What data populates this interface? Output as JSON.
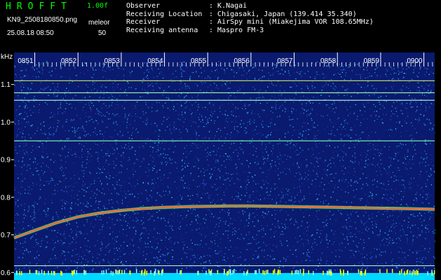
{
  "header": {
    "app_title": "HROFFT",
    "version": "1.00f",
    "filename": "KN9_2508180850.png",
    "datetime": "25.08.18 08:50",
    "mode_label": "meleor",
    "mode_value": "50"
  },
  "info": [
    {
      "key": "Observer",
      "sep": ": ",
      "value": "K.Nagai"
    },
    {
      "key": "Receiving Location",
      "sep": ": ",
      "value": "Chigasaki, Japan (139.414 35.340)"
    },
    {
      "key": "Receiver",
      "sep": ": ",
      "value": "AirSpy mini (Miakejima VOR 108.65MHz)"
    },
    {
      "key": "Receiving antenna",
      "sep": ": ",
      "value": "Maspro FM-3"
    }
  ],
  "chart_data": {
    "type": "heatmap",
    "ylabel": "kHz",
    "y_ticks": [
      "1.1",
      "1.0",
      "0.9",
      "0.8",
      "0.7",
      "0.6"
    ],
    "y_values": [
      1.1,
      1.0,
      0.9,
      0.8,
      0.7,
      0.6
    ],
    "ylim": [
      0.58,
      1.185
    ],
    "x_ticks": [
      "0851",
      "0852",
      "0853",
      "0854",
      "0855",
      "0856",
      "0857",
      "0858",
      "0859",
      "0900"
    ],
    "x_values": [
      0,
      1,
      2,
      3,
      4,
      5,
      6,
      7,
      8,
      9
    ],
    "xlim": [
      -0.48,
      9.25
    ],
    "background_color": "#0a1a6e",
    "noise_colors": [
      "#1e3cc8",
      "#2a6cf0",
      "#3aa0ff",
      "#30e0ff"
    ],
    "carrier_lines": [
      {
        "freq": 1.11,
        "color": "#d8ff6a"
      },
      {
        "freq": 1.078,
        "color": "#a0ffb0"
      },
      {
        "freq": 1.058,
        "color": "#b0ffd8"
      },
      {
        "freq": 0.95,
        "color": "#7cffb0"
      },
      {
        "freq": 0.618,
        "color": "#c0ffd0"
      }
    ],
    "doppler_trace": {
      "color": "#ff4030",
      "points": [
        [
          -0.48,
          0.692
        ],
        [
          0.0,
          0.712
        ],
        [
          0.5,
          0.732
        ],
        [
          1.0,
          0.748
        ],
        [
          1.5,
          0.758
        ],
        [
          2.0,
          0.765
        ],
        [
          2.5,
          0.77
        ],
        [
          3.0,
          0.773
        ],
        [
          3.5,
          0.775
        ],
        [
          4.0,
          0.776
        ],
        [
          4.5,
          0.777
        ],
        [
          5.0,
          0.777
        ],
        [
          5.5,
          0.776
        ],
        [
          6.0,
          0.775
        ],
        [
          6.5,
          0.774
        ],
        [
          7.0,
          0.773
        ],
        [
          7.5,
          0.772
        ],
        [
          8.0,
          0.771
        ],
        [
          8.5,
          0.77
        ],
        [
          9.25,
          0.768
        ]
      ]
    },
    "bottom_band_color": "#00d8ff"
  }
}
